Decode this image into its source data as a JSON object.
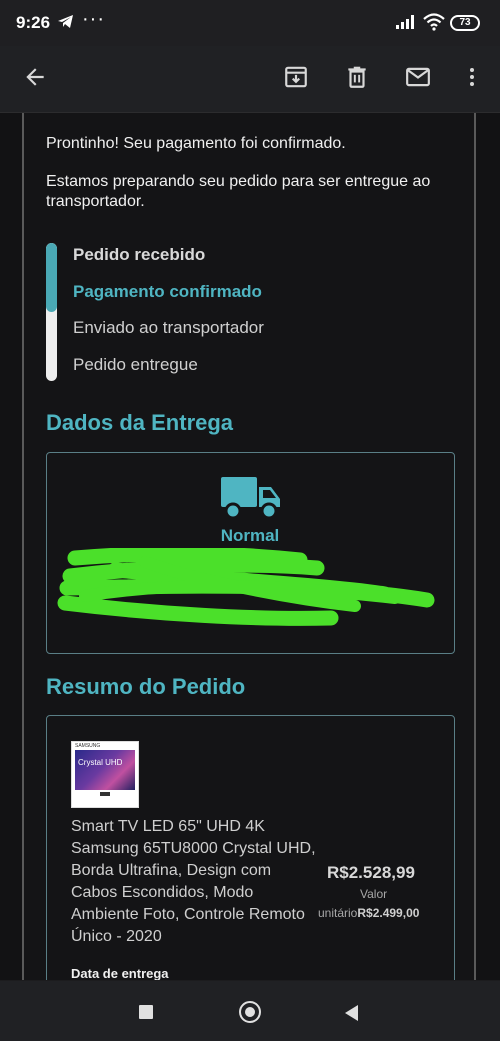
{
  "status_bar": {
    "time": "9:26",
    "more": "···",
    "battery": "73"
  },
  "app_bar": {
    "back_icon": "arrow-back-icon",
    "actions": [
      "archive-icon",
      "delete-icon",
      "mail-icon",
      "more-vert-icon"
    ]
  },
  "email": {
    "intro": "Prontinho! Seu pagamento foi confirmado.",
    "message": "Estamos preparando seu pedido para ser entregue ao transportador.",
    "progress": {
      "completed_fraction": 0.5,
      "steps": [
        {
          "label": "Pedido recebido",
          "state": "done"
        },
        {
          "label": "Pagamento confirmado",
          "state": "current"
        },
        {
          "label": "Enviado ao transportador",
          "state": "pending"
        },
        {
          "label": "Pedido entregue",
          "state": "pending"
        }
      ]
    },
    "delivery": {
      "heading": "Dados da Entrega",
      "icon": "truck-icon",
      "shipping_type": "Normal"
    },
    "summary": {
      "heading": "Resumo do Pedido",
      "product": {
        "thumb_brand": "SAMSUNG",
        "thumb_text": "Crystal UHD",
        "name": "Smart TV LED 65\" UHD 4K Samsung 65TU8000 Crystal UHD, Borda Ultrafina, Design com Cabos Escondidos, Modo Ambiente Foto, Controle Remoto Único - 2020",
        "price": "R$2.528,99",
        "valor_label": "Valor",
        "unit_label": "unitário",
        "unit_price": "R$2.499,00"
      },
      "date_label": "Data de entrega"
    }
  },
  "colors": {
    "accent": "#4fb5c2",
    "background": "#121214",
    "scribble": "#4be02a"
  }
}
